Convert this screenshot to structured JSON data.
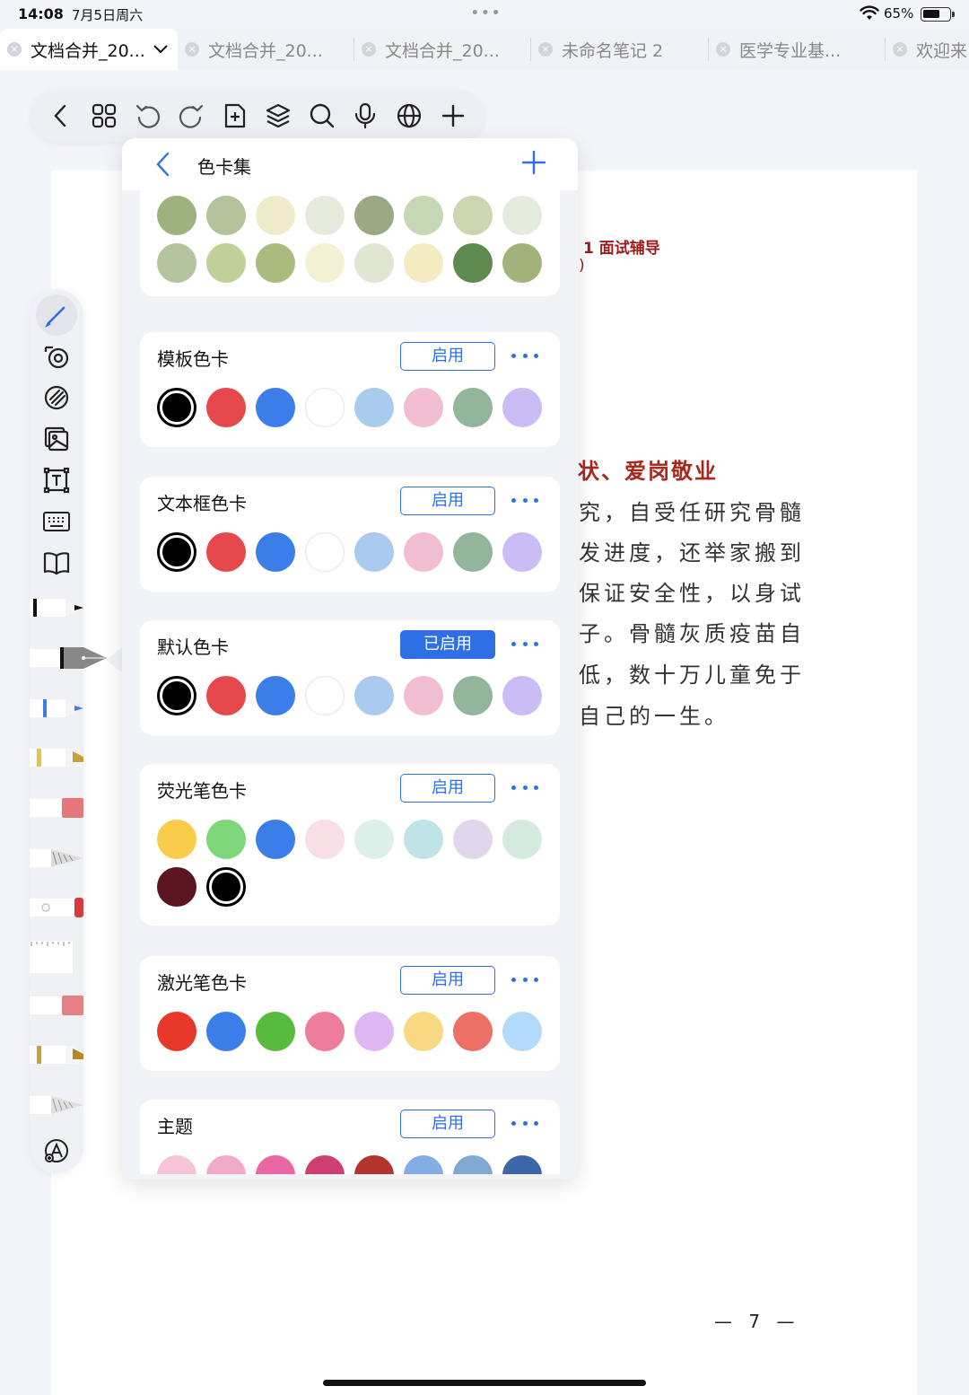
{
  "status": {
    "time": "14:08",
    "date": "7月5日周六",
    "battery": "65%",
    "battery_level": 0.65
  },
  "tabs": [
    {
      "label": "文档合并_20...",
      "active": true
    },
    {
      "label": "文档合并_20..."
    },
    {
      "label": "文档合并_20..."
    },
    {
      "label": "未命名笔记 2"
    },
    {
      "label": "医学专业基..."
    },
    {
      "label": "欢迎来"
    }
  ],
  "toolbar_icons": [
    "back-icon",
    "grid-icon",
    "undo-icon",
    "redo-icon",
    "add-page-icon",
    "layers-icon",
    "search-icon",
    "microphone-icon",
    "globe-icon",
    "plus-icon"
  ],
  "left_tools": [
    "pencil-icon",
    "lasso-icon",
    "eraser-icon",
    "image-icon",
    "text-box-icon",
    "keyboard-icon",
    "book-icon"
  ],
  "document": {
    "heading": "1 面试辅导",
    "paren": ")",
    "title": "状、爱岗敬业",
    "lines": [
      "究，自受任研究骨髓",
      "发进度，还举家搬到",
      "保证安全性，以身试",
      "子。骨髓灰质疫苗自",
      "低，数十万儿童免于",
      "自己的一生。"
    ],
    "page_number": "— 7 —"
  },
  "panel": {
    "title": "色卡集",
    "top_palette": {
      "rows": [
        [
          "#9db27f",
          "#b5c39d",
          "#f1ebcd",
          "#e6eadb",
          "#9ba884",
          "#c5d8b5",
          "#c9d6ae",
          "#e6ecdd"
        ],
        [
          "#b3c49e",
          "#bfd09a",
          "#a9bc7d",
          "#f4f0d4",
          "#e1e6d3",
          "#f4ebc0",
          "#5f8a4e",
          "#a1b27b"
        ]
      ]
    },
    "cards": [
      {
        "title": "模板色卡",
        "button": "启用",
        "enabled": false,
        "colors": [
          "#000000",
          "#e5484d",
          "#3b7de9",
          "#ffffff",
          "#a9cbee",
          "#f1bdd0",
          "#93b59a",
          "#cbbcf6"
        ],
        "selected": 0
      },
      {
        "title": "文本框色卡",
        "button": "启用",
        "enabled": false,
        "colors": [
          "#000000",
          "#e5484d",
          "#3b7de9",
          "#ffffff",
          "#a9cbee",
          "#f1bdd0",
          "#93b59a",
          "#cbbcf6"
        ],
        "selected": 0
      },
      {
        "title": "默认色卡",
        "button": "已启用",
        "enabled": true,
        "colors": [
          "#000000",
          "#e5484d",
          "#3b7de9",
          "#ffffff",
          "#a9cbee",
          "#f1bdd0",
          "#93b59a",
          "#cbbcf6"
        ],
        "selected": 0
      },
      {
        "title": "荧光笔色卡",
        "button": "启用",
        "enabled": false,
        "colors": [
          "#f9cd4b",
          "#7ed67b",
          "#3b7de9",
          "#f8dee5",
          "#dcefe9",
          "#bfe3e6",
          "#e2d6ec",
          "#d6ebdf",
          "#5a1520",
          "#000000"
        ],
        "selected": 9
      },
      {
        "title": "激光笔色卡",
        "button": "启用",
        "enabled": false,
        "colors": [
          "#e8382a",
          "#3b7de9",
          "#57bc3d",
          "#ee7d9b",
          "#deb8f5",
          "#f8d982",
          "#ec7065",
          "#b3daf8"
        ],
        "selected": -1
      },
      {
        "title": "主题",
        "button": "启用",
        "enabled": false,
        "colors": [
          "#f6c6d8",
          "#f1a9cc",
          "#e868a5",
          "#cc3f70",
          "#b3342d",
          "#82aee4",
          "#7fa9d0",
          "#3c66a8"
        ],
        "selected": -1
      }
    ]
  },
  "colors": {
    "accent": "#2f6fe6",
    "heading_red": "#9b1c1c"
  }
}
